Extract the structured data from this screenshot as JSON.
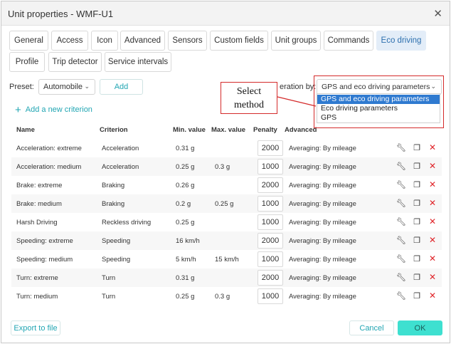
{
  "window": {
    "title": "Unit properties - WMF-U1"
  },
  "tabs_row1": [
    "General",
    "Access",
    "Icon",
    "Advanced",
    "Sensors",
    "Custom fields",
    "Unit groups",
    "Commands",
    "Eco driving"
  ],
  "tabs_row2": [
    "Profile",
    "Trip detector",
    "Service intervals"
  ],
  "active_tab": "Eco driving",
  "toolbar": {
    "preset_label": "Preset:",
    "preset_value": "Automobile",
    "add_label": "Add",
    "calc_label": "eration by:",
    "calc_value": "GPS and eco driving parameters"
  },
  "add_criterion_label": "Add a new criterion",
  "table": {
    "headers": [
      "Name",
      "Criterion",
      "Min. value",
      "Max. value",
      "Penalty",
      "Advanced"
    ],
    "rows": [
      {
        "name": "Acceleration: extreme",
        "criterion": "Acceleration",
        "min": "0.31 g",
        "max": "",
        "penalty": "2000",
        "advanced": "Averaging: By mileage"
      },
      {
        "name": "Acceleration: medium",
        "criterion": "Acceleration",
        "min": "0.25 g",
        "max": "0.3 g",
        "penalty": "1000",
        "advanced": "Averaging: By mileage"
      },
      {
        "name": "Brake: extreme",
        "criterion": "Braking",
        "min": "0.26 g",
        "max": "",
        "penalty": "2000",
        "advanced": "Averaging: By mileage"
      },
      {
        "name": "Brake: medium",
        "criterion": "Braking",
        "min": "0.2 g",
        "max": "0.25 g",
        "penalty": "1000",
        "advanced": "Averaging: By mileage"
      },
      {
        "name": "Harsh Driving",
        "criterion": "Reckless driving",
        "min": "0.25 g",
        "max": "",
        "penalty": "1000",
        "advanced": "Averaging: By mileage"
      },
      {
        "name": "Speeding: extreme",
        "criterion": "Speeding",
        "min": "16 km/h",
        "max": "",
        "penalty": "2000",
        "advanced": "Averaging: By mileage"
      },
      {
        "name": "Speeding: medium",
        "criterion": "Speeding",
        "min": "5 km/h",
        "max": "15 km/h",
        "penalty": "1000",
        "advanced": "Averaging: By mileage"
      },
      {
        "name": "Turn: extreme",
        "criterion": "Turn",
        "min": "0.31 g",
        "max": "",
        "penalty": "2000",
        "advanced": "Averaging: By mileage"
      },
      {
        "name": "Turn: medium",
        "criterion": "Turn",
        "min": "0.25 g",
        "max": "0.3 g",
        "penalty": "1000",
        "advanced": "Averaging: By mileage"
      }
    ]
  },
  "dropdown": {
    "options": [
      "GPS and eco driving parameters",
      "Eco driving parameters",
      "GPS"
    ],
    "selected_index": 0
  },
  "callout": {
    "text": "Select method"
  },
  "footer": {
    "export_label": "Export to file",
    "cancel_label": "Cancel",
    "ok_label": "OK"
  },
  "colors": {
    "accent": "#22a6b3",
    "ok_button": "#3ee0d0",
    "active_tab_bg": "#e3edf8",
    "delete": "#e0252a",
    "annotation": "#d42a2a",
    "selected_option": "#2f7ad0"
  },
  "icons": {
    "close": "close-icon",
    "row_actions": [
      "wrench-icon",
      "copy-icon",
      "delete-icon"
    ],
    "add": "plus-icon"
  }
}
